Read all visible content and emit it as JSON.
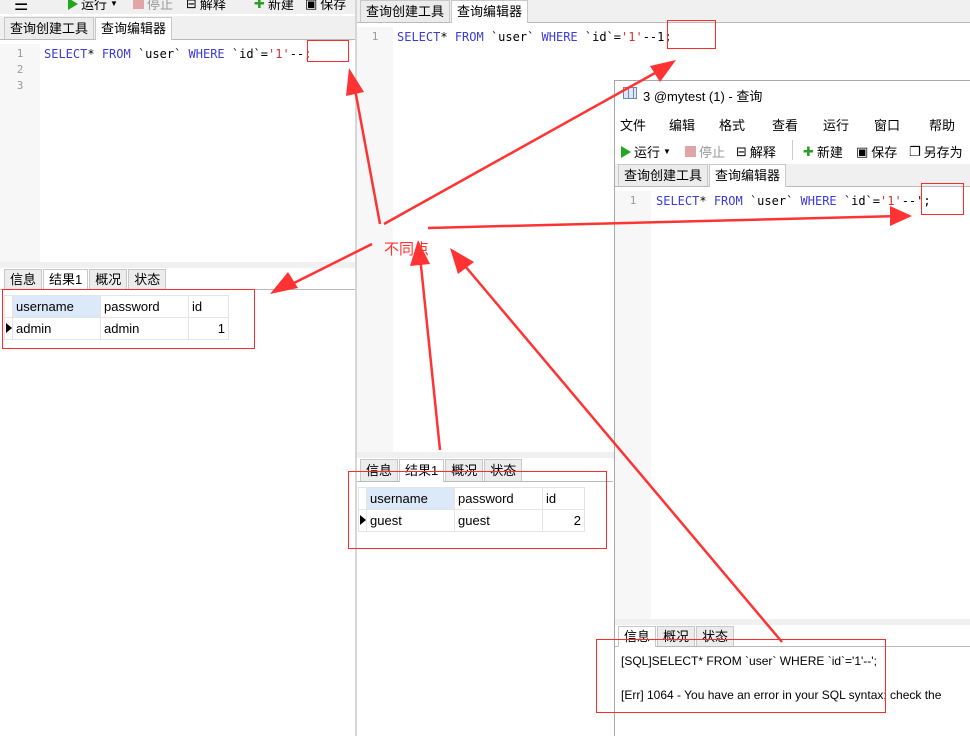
{
  "left": {
    "toolbar": {
      "run": "运行",
      "stop": "停止",
      "explain": "解释",
      "new": "新建",
      "save": "保存"
    },
    "tabs": [
      "查询创建工具",
      "查询编辑器"
    ],
    "line_numbers": [
      "1",
      "2",
      "3"
    ],
    "sql": {
      "kw1": "SELECT",
      "p1": "* ",
      "kw2": "FROM",
      "p2": " `user` ",
      "kw3": "WHERE",
      "p3": " `id`=",
      "s1": "'1'",
      "p4": "--;"
    },
    "result_tabs": [
      "信息",
      "结果1",
      "概况",
      "状态"
    ],
    "columns": [
      "username",
      "password",
      "id"
    ],
    "row": [
      "admin",
      "admin",
      "1"
    ]
  },
  "mid": {
    "tabs": [
      "查询创建工具",
      "查询编辑器"
    ],
    "line_numbers": [
      "1"
    ],
    "sql": {
      "kw1": "SELECT",
      "p1": "* ",
      "kw2": "FROM",
      "p2": " `user` ",
      "kw3": "WHERE",
      "p3": " `id`=",
      "s1": "'1'",
      "p4": "--1;"
    },
    "result_tabs": [
      "信息",
      "结果1",
      "概况",
      "状态"
    ],
    "columns": [
      "username",
      "password",
      "id"
    ],
    "row": [
      "guest",
      "guest",
      "2"
    ]
  },
  "right": {
    "title": "3 @mytest (1) - 查询",
    "menu": [
      "文件",
      "编辑",
      "格式",
      "查看",
      "运行",
      "窗口",
      "帮助"
    ],
    "toolbar": {
      "run": "运行",
      "stop": "停止",
      "explain": "解释",
      "new": "新建",
      "save": "保存",
      "save_as": "另存为"
    },
    "tabs": [
      "查询创建工具",
      "查询编辑器"
    ],
    "line_numbers": [
      "1"
    ],
    "sql": {
      "kw1": "SELECT",
      "p1": "* ",
      "kw2": "FROM",
      "p2": " `user` ",
      "kw3": "WHERE",
      "p3": " `id`=",
      "s1": "'1'",
      "p4": "--';"
    },
    "result_tabs": [
      "信息",
      "概况",
      "状态"
    ],
    "messages": [
      "[SQL]SELECT* FROM `user` WHERE `id`='1'--';",
      "[Err] 1064 - You have an error in your SQL syntax; check the"
    ]
  },
  "annotation": {
    "label": "不同点",
    "color": "#ff3333"
  }
}
